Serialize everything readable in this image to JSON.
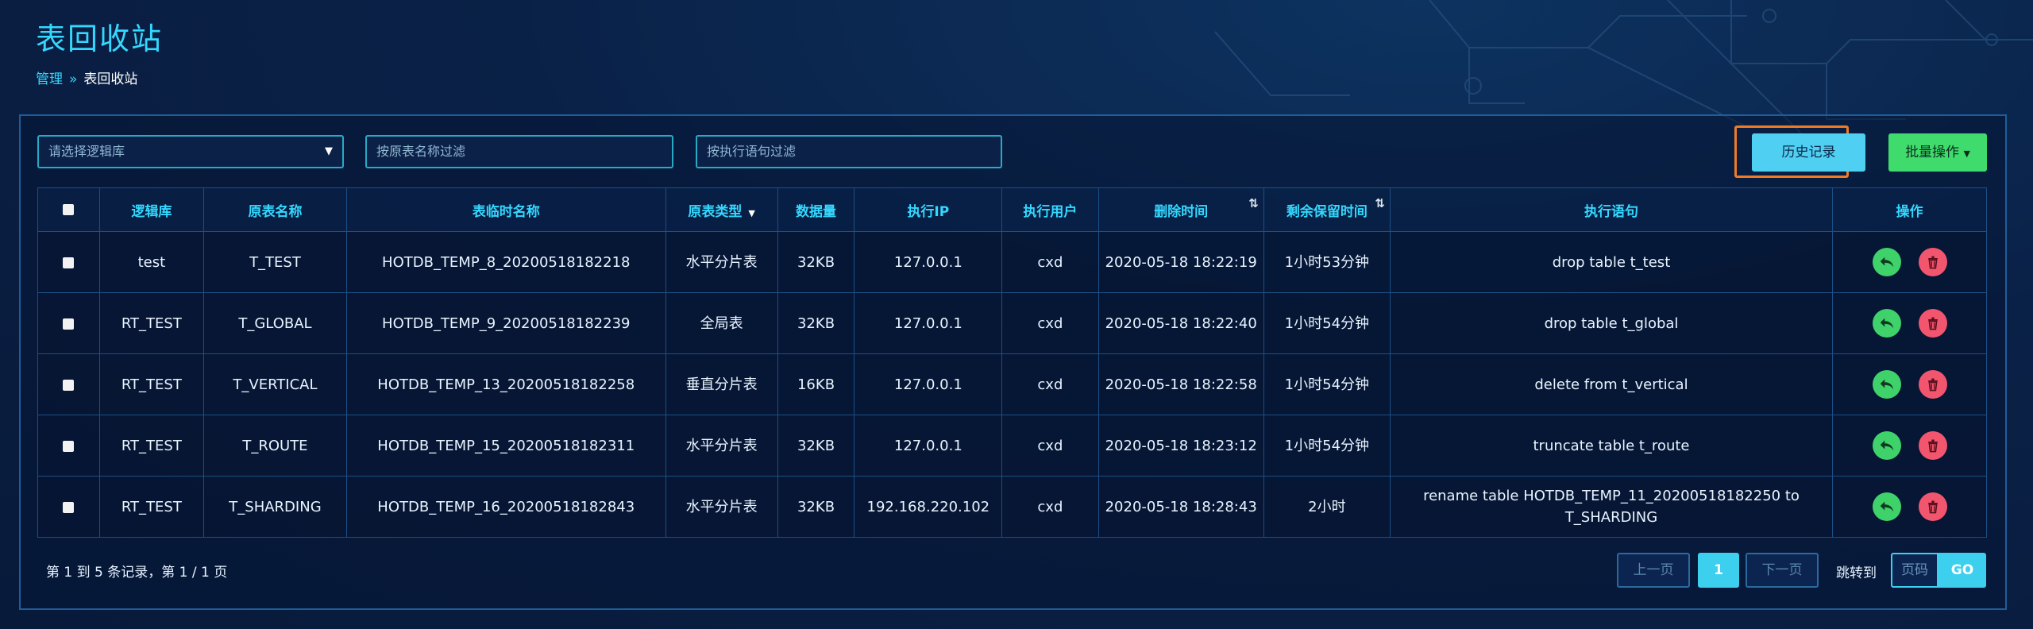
{
  "header": {
    "title": "表回收站"
  },
  "breadcrumb": {
    "parent": "管理",
    "separator": "»",
    "current": "表回收站"
  },
  "filters": {
    "db_placeholder": "请选择逻辑库",
    "table_placeholder": "按原表名称过滤",
    "stmt_placeholder": "按执行语句过滤"
  },
  "toolbar": {
    "history_label": "历史记录",
    "batch_label": "批量操作"
  },
  "table": {
    "columns": [
      "逻辑库",
      "原表名称",
      "表临时名称",
      "原表类型",
      "数据量",
      "执行IP",
      "执行用户",
      "删除时间",
      "剩余保留时间",
      "执行语句",
      "操作"
    ],
    "rows": [
      {
        "db": "test",
        "orig": "T_TEST",
        "temp": "HOTDB_TEMP_8_20200518182218",
        "type": "水平分片表",
        "size": "32KB",
        "ip": "127.0.0.1",
        "user": "cxd",
        "time": "2020-05-18 18:22:19",
        "remain": "1小时53分钟",
        "stmt": "drop table t_test"
      },
      {
        "db": "RT_TEST",
        "orig": "T_GLOBAL",
        "temp": "HOTDB_TEMP_9_20200518182239",
        "type": "全局表",
        "size": "32KB",
        "ip": "127.0.0.1",
        "user": "cxd",
        "time": "2020-05-18 18:22:40",
        "remain": "1小时54分钟",
        "stmt": "drop table t_global"
      },
      {
        "db": "RT_TEST",
        "orig": "T_VERTICAL",
        "temp": "HOTDB_TEMP_13_20200518182258",
        "type": "垂直分片表",
        "size": "16KB",
        "ip": "127.0.0.1",
        "user": "cxd",
        "time": "2020-05-18 18:22:58",
        "remain": "1小时54分钟",
        "stmt": "delete from t_vertical"
      },
      {
        "db": "RT_TEST",
        "orig": "T_ROUTE",
        "temp": "HOTDB_TEMP_15_20200518182311",
        "type": "水平分片表",
        "size": "32KB",
        "ip": "127.0.0.1",
        "user": "cxd",
        "time": "2020-05-18 18:23:12",
        "remain": "1小时54分钟",
        "stmt": "truncate table t_route"
      },
      {
        "db": "RT_TEST",
        "orig": "T_SHARDING",
        "temp": "HOTDB_TEMP_16_20200518182843",
        "type": "水平分片表",
        "size": "32KB",
        "ip": "192.168.220.102",
        "user": "cxd",
        "time": "2020-05-18 18:28:43",
        "remain": "2小时",
        "stmt": "rename table HOTDB_TEMP_11_20200518182250 to T_SHARDING"
      }
    ]
  },
  "footer": {
    "summary": "第 1 到 5 条记录，第 1 / 1 页",
    "prev": "上一页",
    "current_page": "1",
    "next": "下一页",
    "jump_label": "跳转到",
    "page_placeholder": "页码",
    "go": "GO"
  },
  "colors": {
    "accent": "#34d8ff",
    "history": "#4fd0f2",
    "batch": "#3fdc6d",
    "restore": "#3fd16a",
    "delete": "#f2566e",
    "highlight": "#f07b24"
  }
}
